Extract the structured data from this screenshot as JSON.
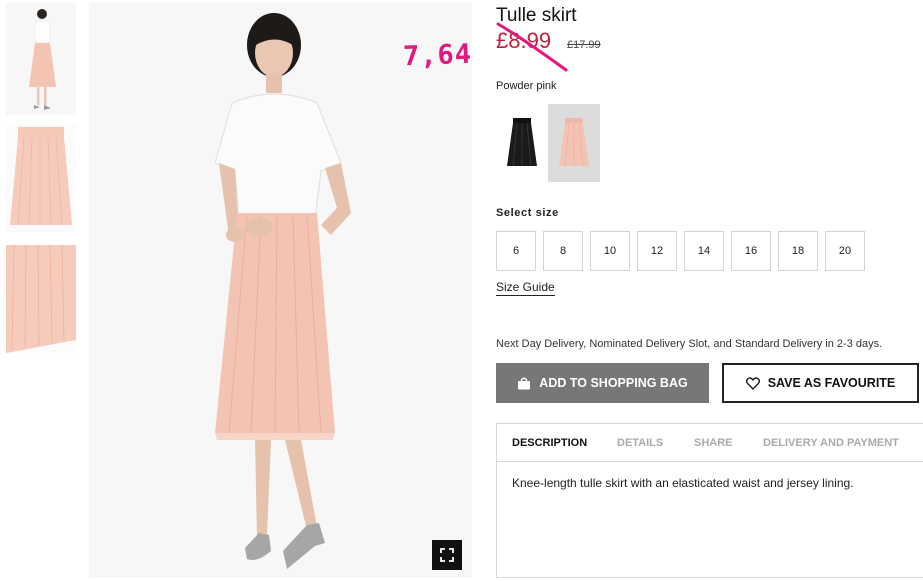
{
  "product": {
    "title": "Tulle skirt",
    "sale_price": "£8.99",
    "old_price": "£17.99",
    "handwritten_note": "7,64",
    "color_name": "Powder pink"
  },
  "sizes": {
    "label": "Select size",
    "options": [
      "6",
      "8",
      "10",
      "12",
      "14",
      "16",
      "18",
      "20"
    ],
    "guide_label": "Size Guide"
  },
  "delivery": {
    "note": "Next Day Delivery, Nominated Delivery Slot, and Standard Delivery in 2-3 days."
  },
  "actions": {
    "add_to_bag_label": "ADD TO SHOPPING BAG",
    "favourite_label": "SAVE AS FAVOURITE"
  },
  "tabs": {
    "items": [
      "DESCRIPTION",
      "DETAILS",
      "SHARE",
      "DELIVERY AND PAYMENT"
    ],
    "active": "DESCRIPTION"
  },
  "description": {
    "text": "Knee-length tulle skirt with an elasticated waist and jersey lining."
  },
  "icons": {
    "bag": "shopping-bag-icon",
    "favourite": "heart-icon",
    "zoom": "expand-icon"
  },
  "colors": {
    "accent_sale": "#c0213c",
    "annotation": "#e0197f",
    "add_to_bag_bg": "#777777",
    "skirt_pink": "#f3c4b3"
  }
}
